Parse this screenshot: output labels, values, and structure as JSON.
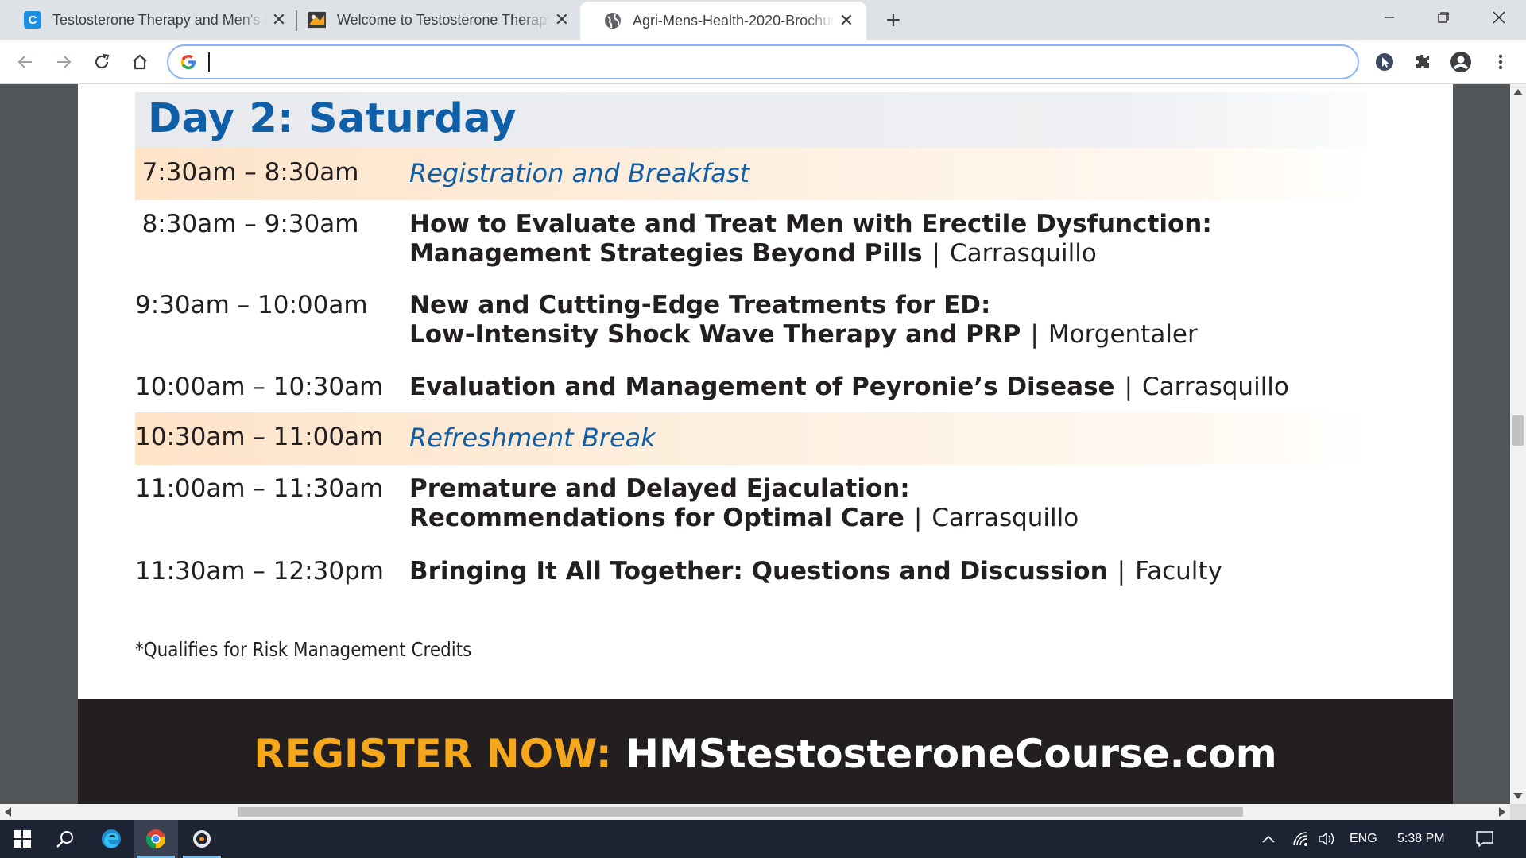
{
  "browser": {
    "tabs": [
      {
        "title": "Testosterone Therapy and Men's Health",
        "favicon": "c-logo-icon",
        "active": false
      },
      {
        "title": "Welcome to Testosterone Therapy",
        "favicon": "site-logo-icon",
        "active": false
      },
      {
        "title": "Agri-Mens-Health-2020-Brochure.pdf",
        "favicon": "globe-icon",
        "active": true
      }
    ],
    "new_tab_label": "+",
    "address_bar": {
      "value": "",
      "placeholder": ""
    },
    "colors": {
      "tabstrip": "#dee1e6",
      "accent": "#1a73e8"
    }
  },
  "document": {
    "day_title": "Day 2: Saturday",
    "schedule": [
      {
        "time": "7:30am – 8:30am",
        "title": "Registration and Breakfast",
        "is_break": true
      },
      {
        "time": "8:30am – 9:30am",
        "lines": [
          "How to Evaluate and Treat Men with Erectile Dysfunction:",
          "Management Strategies Beyond Pills"
        ],
        "speaker": "Carrasquillo"
      },
      {
        "time": "9:30am – 10:00am",
        "lines": [
          "New and Cutting-Edge Treatments for ED:",
          "Low-Intensity Shock Wave Therapy and PRP"
        ],
        "speaker": "Morgentaler"
      },
      {
        "time": "10:00am – 10:30am",
        "lines": [
          "Evaluation and Management of Peyronie’s Disease"
        ],
        "speaker": "Carrasquillo"
      },
      {
        "time": "10:30am – 11:00am",
        "title": "Refreshment Break",
        "is_break": true
      },
      {
        "time": "11:00am – 11:30am",
        "lines": [
          "Premature and Delayed Ejaculation:",
          "Recommendations for Optimal Care"
        ],
        "speaker": "Carrasquillo"
      },
      {
        "time": "11:30am – 12:30pm",
        "lines": [
          "Bringing It All Together: Questions and Discussion"
        ],
        "speaker": "Faculty"
      }
    ],
    "separator": "|",
    "footnote": "*Qualifies for Risk Management Credits",
    "banner": {
      "label": "REGISTER NOW:",
      "url": "HMStestosteroneCourse.com"
    },
    "colors": {
      "heading_blue": "#0f5ea8",
      "banner_orange": "#f6a81c",
      "banner_bg": "#231f20",
      "break_bg": "#fde3c8"
    }
  },
  "scrollbars": {
    "vertical_position": 0.48,
    "horizontal_thumb_start": 0.15,
    "horizontal_thumb_end": 0.83
  },
  "taskbar": {
    "apps": [
      "windows-start-icon",
      "search-icon",
      "edge-icon",
      "chrome-icon",
      "media-player-icon"
    ],
    "tray": {
      "language": "ENG",
      "time": "5:38 PM"
    }
  }
}
